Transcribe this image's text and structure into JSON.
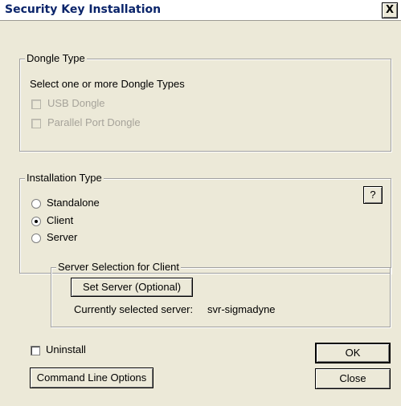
{
  "window": {
    "title": "Security Key Installation",
    "close_label": "X"
  },
  "dongle_type": {
    "legend": "Dongle Type",
    "prompt": "Select one or more Dongle Types",
    "options": [
      {
        "label": "USB Dongle",
        "checked": false,
        "enabled": false
      },
      {
        "label": "Parallel Port Dongle",
        "checked": false,
        "enabled": false
      }
    ]
  },
  "installation_type": {
    "legend": "Installation Type",
    "help_label": "?",
    "options": [
      {
        "label": "Standalone",
        "selected": false
      },
      {
        "label": "Client",
        "selected": true
      },
      {
        "label": "Server",
        "selected": false
      }
    ]
  },
  "server_selection": {
    "legend": "Server Selection for Client",
    "button_label": "Set Server (Optional)",
    "current_label": "Currently selected server:",
    "current_value": "svr-sigmadyne"
  },
  "footer": {
    "uninstall_label": "Uninstall",
    "uninstall_checked": false,
    "command_line_label": "Command Line Options",
    "ok_label": "OK",
    "close_label": "Close"
  }
}
